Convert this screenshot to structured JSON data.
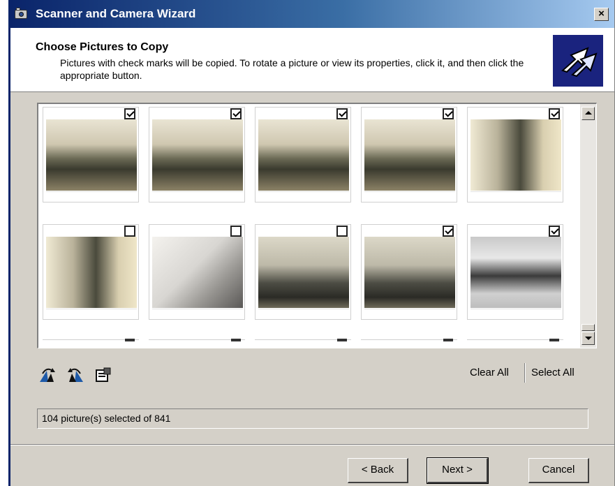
{
  "window": {
    "title": "Scanner and Camera Wizard",
    "close_label": "×"
  },
  "header": {
    "title": "Choose Pictures to Copy",
    "description": "Pictures with check marks will be copied. To rotate a picture or view its properties, click it, and then click the appropriate button."
  },
  "thumbnails": [
    {
      "checked": true,
      "scene": "lab-crowd"
    },
    {
      "checked": true,
      "scene": "lab-crowd"
    },
    {
      "checked": true,
      "scene": "lab-crowd"
    },
    {
      "checked": true,
      "scene": "lab-crowd"
    },
    {
      "checked": true,
      "scene": "rotated-lab"
    },
    {
      "checked": false,
      "scene": "rotated-lab"
    },
    {
      "checked": false,
      "scene": "corner-wall"
    },
    {
      "checked": false,
      "scene": "office-people"
    },
    {
      "checked": true,
      "scene": "office-people"
    },
    {
      "checked": true,
      "scene": "device-dials"
    }
  ],
  "toolbar": {
    "rotate_clockwise_icon": "rotate-clockwise-icon",
    "rotate_counterclockwise_icon": "rotate-counterclockwise-icon",
    "properties_icon": "properties-icon",
    "clear_all_label": "Clear All",
    "select_all_label": "Select All"
  },
  "status": {
    "text": "104 picture(s) selected of 841"
  },
  "buttons": {
    "back_label": "< Back",
    "next_label": "Next >",
    "cancel_label": "Cancel"
  },
  "colors": {
    "title_bar_start": "#0a246a",
    "title_bar_end": "#a6caf0",
    "dialog_face": "#d4d0c8",
    "logo_bg": "#1a237e"
  }
}
